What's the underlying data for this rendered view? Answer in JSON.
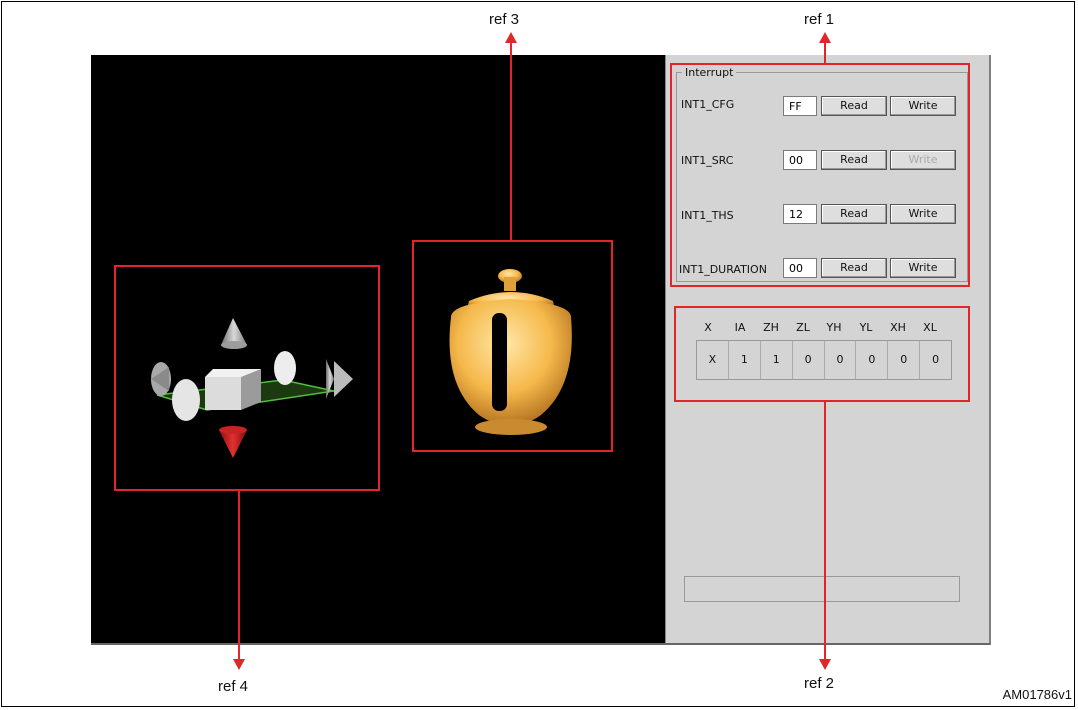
{
  "refs": {
    "ref1": "ref 1",
    "ref2": "ref 2",
    "ref3": "ref 3",
    "ref4": "ref 4"
  },
  "figure_id": "AM01786v1",
  "interrupt": {
    "group_title": "Interrupt",
    "read_label": "Read",
    "write_label": "Write",
    "registers": [
      {
        "name": "INT1_CFG",
        "value": "FF",
        "write_enabled": true
      },
      {
        "name": "INT1_SRC",
        "value": "00",
        "write_enabled": false
      },
      {
        "name": "INT1_THS",
        "value": "12",
        "write_enabled": true
      },
      {
        "name": "INT1_DURATION",
        "value": "00",
        "write_enabled": true
      }
    ]
  },
  "source": {
    "headers": [
      "X",
      "IA",
      "ZH",
      "ZL",
      "YH",
      "YL",
      "XH",
      "XL"
    ],
    "values": [
      "X",
      "1",
      "1",
      "0",
      "0",
      "0",
      "0",
      "0"
    ]
  },
  "colors": {
    "annotation": "#e0262a",
    "viewport_bg": "#000000",
    "panel_bg": "#d4d4d4",
    "teapot": "#f5b84a"
  }
}
